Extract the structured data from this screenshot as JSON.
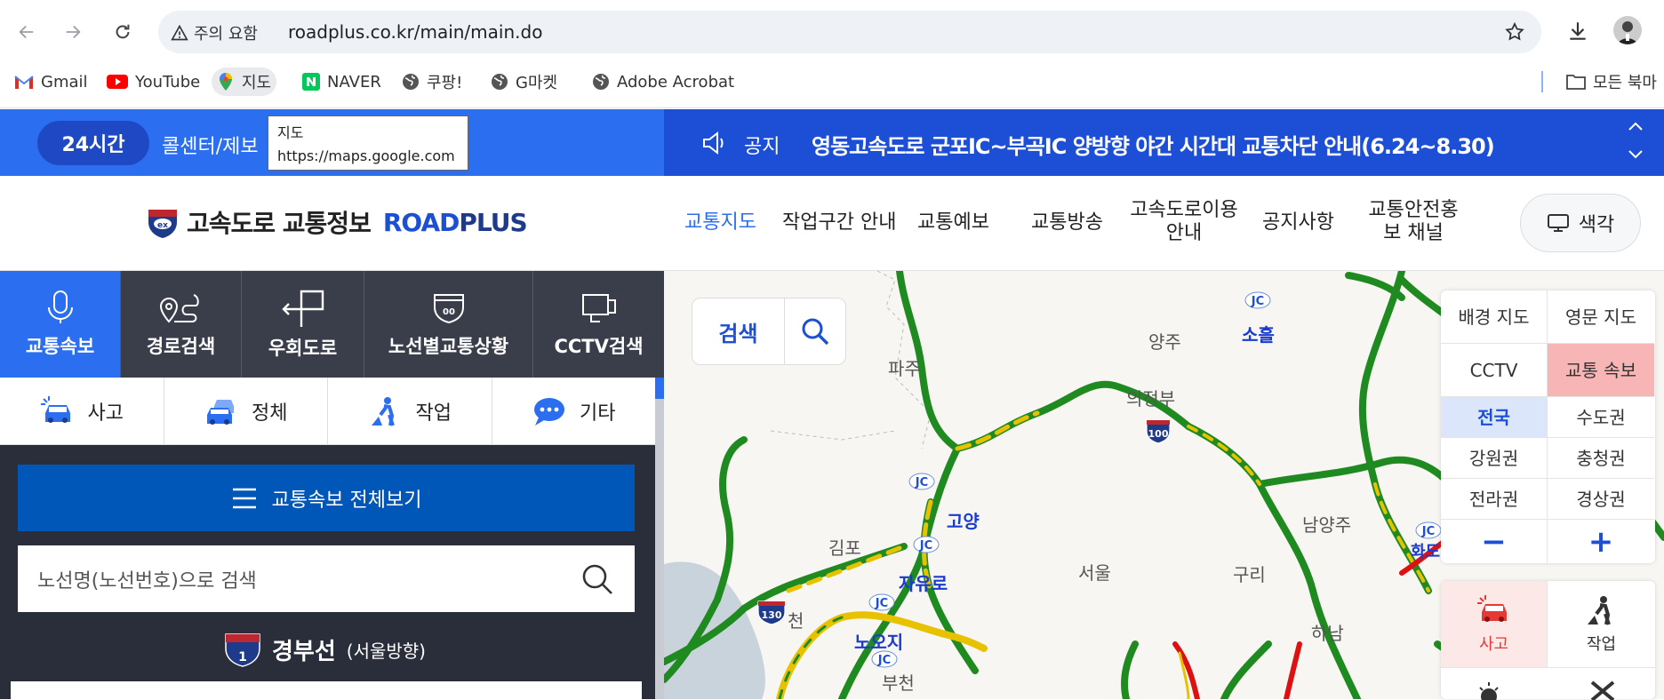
{
  "browser": {
    "security_label": "주의 요함",
    "url": "roadplus.co.kr/main/main.do",
    "bookmarks": [
      "Gmail",
      "YouTube",
      "지도",
      "NAVER",
      "쿠팡!",
      "G마켓",
      "Adobe Acrobat"
    ],
    "all_bookmarks": "모든 북마"
  },
  "tooltip": {
    "title": "지도",
    "url": "https://maps.google.com"
  },
  "notice": {
    "badge": "24시간",
    "callcenter": "콜센터/제보",
    "label": "공지",
    "text": "영동고속도로 군포IC~부곡IC 양방향 야간 시간대 교통차단 안내(6.24~8.30)"
  },
  "header": {
    "logo_text": "고속도로 교통정보",
    "logo_brand_road": "ROAD",
    "logo_brand_plus": "PLUS",
    "menu": [
      "교통지도",
      "작업구간 안내",
      "교통예보",
      "교통방송",
      "고속도로이용 안내",
      "공지사항",
      "교통안전홍보 채널"
    ],
    "color_button": "색각"
  },
  "left": {
    "tabs": [
      "교통속보",
      "경로검색",
      "우회도로",
      "노선별교통상황",
      "CCTV검색"
    ],
    "subtabs": [
      "사고",
      "정체",
      "작업",
      "기타"
    ],
    "all_view": "교통속보 전체보기",
    "route_search_placeholder": "노선명(노선번호)으로 검색",
    "route": {
      "number": "1",
      "name": "경부선",
      "direction": "(서울방향)"
    }
  },
  "map": {
    "search_label": "검색",
    "labels": [
      "양주",
      "의정부",
      "파주",
      "김포",
      "서울",
      "남양주",
      "하남",
      "구리",
      "고양",
      "자유로",
      "노오지",
      "부천",
      "천",
      "화도",
      "소흘"
    ],
    "route_shields": [
      "100",
      "130"
    ],
    "jc": "JC"
  },
  "controls": {
    "map_type": [
      "배경 지도",
      "영문 지도"
    ],
    "layers": [
      "CCTV",
      "교통 속보"
    ],
    "regions": [
      "전국",
      "수도권",
      "강원권",
      "충청권",
      "전라권",
      "경상권"
    ],
    "zoom_out": "−",
    "zoom_in": "+",
    "filters": [
      "사고",
      "작업"
    ]
  },
  "colors": {
    "accent_blue": "#2b6ef0",
    "dark_blue": "#1d4fd6",
    "panel_dark": "#2a2d3a",
    "road_green": "#1f8a1f",
    "road_yellow": "#e8c200",
    "road_red": "#d11"
  }
}
